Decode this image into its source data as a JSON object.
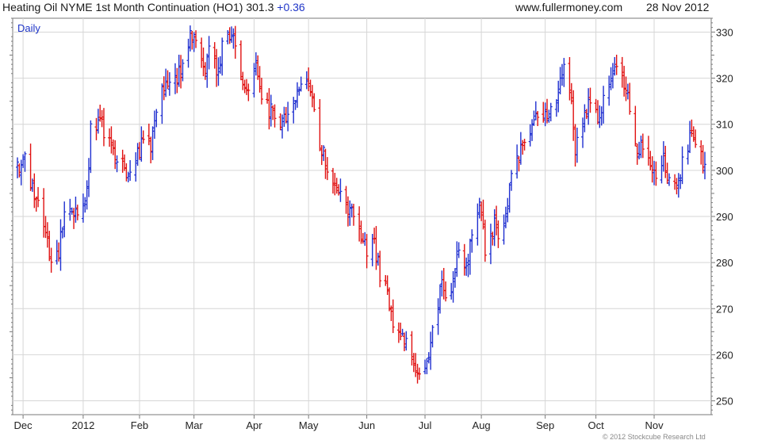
{
  "header": {
    "title": "Heating Oil NYME 1st Month Continuation (HO1)",
    "last": "301.3",
    "change": "+0.36",
    "site": "www.fullermoney.com",
    "date": "28 Nov 2012"
  },
  "footer": {
    "copyright": "© 2012 Stockcube Research Ltd"
  },
  "colors": {
    "up": "#1f2fd0",
    "down": "#e01010",
    "grid": "#d6d6d6",
    "axis": "#7a7a7a",
    "text": "#222222",
    "label": "#1f35c8"
  },
  "chart_data": {
    "type": "ohlc",
    "period_label": "Daily",
    "y_range": [
      247,
      333
    ],
    "y_ticks": [
      250,
      260,
      270,
      280,
      290,
      300,
      310,
      320,
      330
    ],
    "x_labels": [
      "Dec",
      "2012",
      "Feb",
      "Mar",
      "Apr",
      "May",
      "Jun",
      "Jul",
      "Aug",
      "Sep",
      "Oct",
      "Nov"
    ],
    "x_label_dates": [
      "2011-12-01",
      "2012-01-02",
      "2012-02-01",
      "2012-03-01",
      "2012-04-02",
      "2012-05-01",
      "2012-06-01",
      "2012-07-02",
      "2012-08-01",
      "2012-09-04",
      "2012-10-01",
      "2012-11-01"
    ],
    "x_range": [
      "2011-11-28",
      "2012-11-28"
    ],
    "grid": true,
    "legend": "none",
    "anchors": [
      [
        "2011-11-28",
        300
      ],
      [
        "2011-12-02",
        302
      ],
      [
        "2011-12-06",
        297
      ],
      [
        "2011-12-09",
        292
      ],
      [
        "2011-12-13",
        286
      ],
      [
        "2011-12-16",
        279
      ],
      [
        "2011-12-20",
        283
      ],
      [
        "2011-12-23",
        291
      ],
      [
        "2011-12-30",
        290
      ],
      [
        "2012-01-04",
        295
      ],
      [
        "2012-01-06",
        309
      ],
      [
        "2012-01-11",
        310
      ],
      [
        "2012-01-17",
        305
      ],
      [
        "2012-01-20",
        302
      ],
      [
        "2012-01-25",
        300
      ],
      [
        "2012-01-31",
        303
      ],
      [
        "2012-02-03",
        306
      ],
      [
        "2012-02-07",
        305
      ],
      [
        "2012-02-10",
        312
      ],
      [
        "2012-02-14",
        319
      ],
      [
        "2012-02-21",
        320
      ],
      [
        "2012-02-24",
        322
      ],
      [
        "2012-02-29",
        330
      ],
      [
        "2012-03-02",
        327
      ],
      [
        "2012-03-07",
        322
      ],
      [
        "2012-03-09",
        325
      ],
      [
        "2012-03-14",
        322
      ],
      [
        "2012-03-16",
        327
      ],
      [
        "2012-03-21",
        329
      ],
      [
        "2012-03-26",
        322
      ],
      [
        "2012-03-29",
        318
      ],
      [
        "2012-04-03",
        324
      ],
      [
        "2012-04-06",
        315
      ],
      [
        "2012-04-11",
        313
      ],
      [
        "2012-04-17",
        310
      ],
      [
        "2012-04-20",
        313
      ],
      [
        "2012-04-25",
        316
      ],
      [
        "2012-04-30",
        320
      ],
      [
        "2012-05-02",
        318
      ],
      [
        "2012-05-04",
        312
      ],
      [
        "2012-05-09",
        303
      ],
      [
        "2012-05-11",
        299
      ],
      [
        "2012-05-16",
        296
      ],
      [
        "2012-05-22",
        291
      ],
      [
        "2012-05-25",
        290
      ],
      [
        "2012-05-30",
        285
      ],
      [
        "2012-06-01",
        281
      ],
      [
        "2012-06-05",
        284
      ],
      [
        "2012-06-08",
        278
      ],
      [
        "2012-06-13",
        272
      ],
      [
        "2012-06-15",
        265
      ],
      [
        "2012-06-20",
        263
      ],
      [
        "2012-06-22",
        263
      ],
      [
        "2012-06-27",
        257
      ],
      [
        "2012-06-29",
        254
      ],
      [
        "2012-07-03",
        258
      ],
      [
        "2012-07-06",
        266
      ],
      [
        "2012-07-11",
        275
      ],
      [
        "2012-07-13",
        272
      ],
      [
        "2012-07-18",
        278
      ],
      [
        "2012-07-20",
        283
      ],
      [
        "2012-07-24",
        280
      ],
      [
        "2012-07-27",
        287
      ],
      [
        "2012-07-31",
        294
      ],
      [
        "2012-08-03",
        282
      ],
      [
        "2012-08-08",
        289
      ],
      [
        "2012-08-10",
        284
      ],
      [
        "2012-08-15",
        291
      ],
      [
        "2012-08-17",
        299
      ],
      [
        "2012-08-22",
        304
      ],
      [
        "2012-08-24",
        308
      ],
      [
        "2012-08-29",
        310
      ],
      [
        "2012-08-31",
        311
      ],
      [
        "2012-09-05",
        313
      ],
      [
        "2012-09-10",
        316
      ],
      [
        "2012-09-14",
        322
      ],
      [
        "2012-09-18",
        315
      ],
      [
        "2012-09-20",
        305
      ],
      [
        "2012-09-25",
        311
      ],
      [
        "2012-09-28",
        315
      ],
      [
        "2012-10-03",
        310
      ],
      [
        "2012-10-05",
        316
      ],
      [
        "2012-10-10",
        320
      ],
      [
        "2012-10-12",
        324
      ],
      [
        "2012-10-17",
        318
      ],
      [
        "2012-10-19",
        314
      ],
      [
        "2012-10-23",
        304
      ],
      [
        "2012-10-26",
        306
      ],
      [
        "2012-10-31",
        302
      ],
      [
        "2012-11-02",
        297
      ],
      [
        "2012-11-06",
        302
      ],
      [
        "2012-11-09",
        297
      ],
      [
        "2012-11-14",
        298
      ],
      [
        "2012-11-16",
        301
      ],
      [
        "2012-11-20",
        307
      ],
      [
        "2012-11-23",
        305
      ],
      [
        "2012-11-28",
        301.3
      ]
    ]
  }
}
